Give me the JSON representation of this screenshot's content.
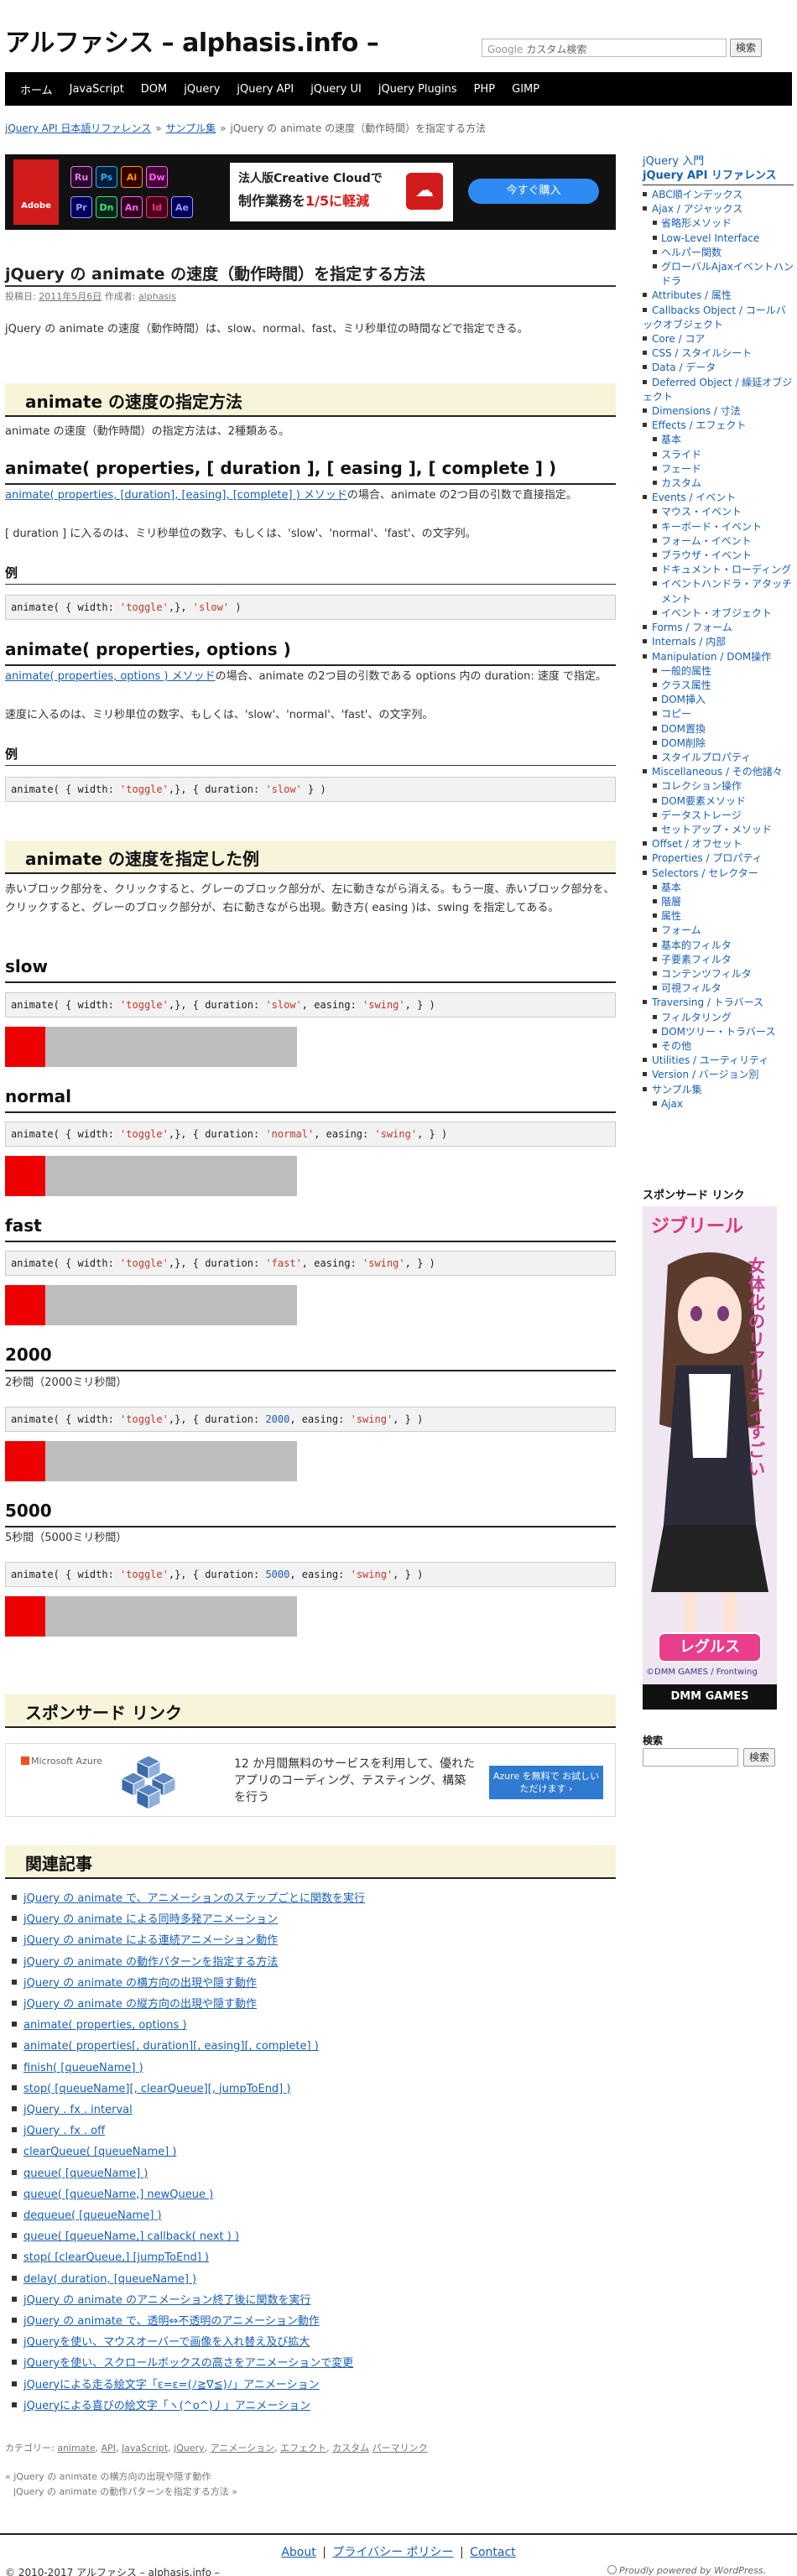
{
  "header": {
    "site_title": "アルファシス – alphasis.info –",
    "search_google": "Google",
    "search_placeholder": "カスタム検索",
    "search_button": "検索"
  },
  "nav": [
    "ホーム",
    "JavaScript",
    "DOM",
    "jQuery",
    "jQuery API",
    "jQuery UI",
    "jQuery Plugins",
    "PHP",
    "GIMP"
  ],
  "breadcrumb": {
    "items": [
      "jQuery API 日本語リファレンス",
      "サンプル集"
    ],
    "current": "jQuery の animate の速度（動作時間）を指定する方法"
  },
  "ad_banner": {
    "brand": "Adobe",
    "apps": [
      {
        "label": "Ru",
        "fg": "#ea77ff",
        "bg": "#2a0a2a"
      },
      {
        "label": "Ps",
        "fg": "#31a8ff",
        "bg": "#001e36"
      },
      {
        "label": "Ai",
        "fg": "#ff9a00",
        "bg": "#330000"
      },
      {
        "label": "Dw",
        "fg": "#ff61f6",
        "bg": "#470137"
      },
      {
        "label": "Pr",
        "fg": "#9999ff",
        "bg": "#00005b"
      },
      {
        "label": "Dn",
        "fg": "#4de36a",
        "bg": "#06261e"
      },
      {
        "label": "An",
        "fg": "#ff61f6",
        "bg": "#2e0019"
      },
      {
        "label": "Id",
        "fg": "#ff3366",
        "bg": "#49021f"
      },
      {
        "label": "Ae",
        "fg": "#9999ff",
        "bg": "#00005b"
      }
    ],
    "line1": "法人版Creative Cloudで",
    "line2_a": "制作業務を",
    "line2_b": "1/5に軽減",
    "cta": "今すぐ購入"
  },
  "post": {
    "title": "jQuery の animate の速度（動作時間）を指定する方法",
    "meta_prefix": "投稿日:",
    "meta_date": "2011年5月6日",
    "meta_author_prefix": "作成者:",
    "meta_author": "alphasis",
    "intro": "jQuery の animate の速度（動作時間）は、slow、normal、fast、ミリ秒単位の時間などで指定できる。",
    "h2_method": "animate の速度の指定方法",
    "method_text": "animate の速度（動作時間）の指定方法は、2種類ある。",
    "h3_a": "animate( properties, [ duration ], [ easing ], [ complete ] )",
    "a_link": "animate( properties, [duration], [easing], [complete] ) メソッド",
    "a_text1": "の場合、animate の2つ目の引数で直接指定。",
    "a_text2": "[ duration ] に入るのは、ミリ秒単位の数字、もしくは、'slow'、'normal'、'fast'、の文字列。",
    "h4_ex1": "例",
    "h3_b": "animate( properties, options )",
    "b_link": "animate( properties, options ) メソッド",
    "b_text1": "の場合、animate の2つ目の引数である options 内の duration: 速度 で指定。",
    "b_text2": "速度に入るのは、ミリ秒単位の数字、もしくは、'slow'、'normal'、'fast'、の文字列。",
    "h4_ex2": "例",
    "h2_example": "animate の速度を指定した例",
    "example_text": "赤いブロック部分を、クリックすると、グレーのブロック部分が、左に動きながら消える。もう一度、赤いブロック部分を、クリックすると、グレーのブロック部分が、右に動きながら出現。動き方( easing )は、swing を指定してある。",
    "h3_slow": "slow",
    "h3_normal": "normal",
    "h3_fast": "fast",
    "h3_2000": "2000",
    "note_2000": "2秒間（2000ミリ秒間）",
    "h3_5000": "5000",
    "note_5000": "5秒間（5000ミリ秒間）"
  },
  "code": {
    "ex1_pre": "animate( { width: ",
    "ex1_str": "'toggle'",
    "ex1_mid": ",}, ",
    "ex1_val": "'slow'",
    "ex1_post": " )",
    "ex2_pre": "animate( { width: ",
    "ex2_str": "'toggle'",
    "ex2_mid": ",}, { duration: ",
    "ex2_val": "'slow'",
    "ex2_post": " } )",
    "slow_val": "'slow'",
    "normal_val": "'normal'",
    "fast_val": "'fast'",
    "v2000": "2000",
    "v5000": "5000",
    "demo_pre": "animate( { width: ",
    "demo_str": "'toggle'",
    "demo_mid": ",}, { duration: ",
    "demo_ease_pre": ", easing: ",
    "demo_ease": "'swing'",
    "demo_post": ", } )"
  },
  "sponsor": {
    "h2": "スポンサード リンク",
    "ms_label": "Microsoft Azure",
    "text": "12 か月間無料のサービスを利用して、優れたアプリのコーディング、テスティング、構築を行う",
    "btn": "Azure を無料で お試しいただけます ›"
  },
  "related": {
    "h2": "関連記事",
    "items": [
      "jQuery の animate で、アニメーションのステップごとに関数を実行",
      "jQuery の animate による同時多発アニメーション",
      "jQuery の animate による連続アニメーション動作",
      "jQuery の animate の動作パターンを指定する方法",
      "jQuery の animate の横方向の出現や隠す動作",
      "jQuery の animate の縦方向の出現や隠す動作",
      "animate( properties, options )",
      "animate( properties[, duration][, easing][, complete] )",
      "finish( [queueName] )",
      "stop( [queueName][, clearQueue][, jumpToEnd] )",
      "jQuery . fx . interval",
      "jQuery . fx . off",
      "clearQueue( [queueName] )",
      "queue( [queueName] )",
      "queue( [queueName,] newQueue )",
      "dequeue( [queueName] )",
      "queue( [queueName,] callback( next ) )",
      "stop( [clearQueue,] [jumpToEnd] )",
      "delay( duration, [queueName] )",
      "jQuery の animate のアニメーション終了後に関数を実行",
      "jQuery の animate で、透明⇔不透明のアニメーション動作",
      "jQueryを使い、マウスオーバーで画像を入れ替え及び拡大",
      "jQueryを使い、スクロールボックスの高さをアニメーションで変更",
      "jQueryによる走る絵文字「ε=ε=(ﾉ≧∇≦)ﾉ」アニメーション",
      "jQueryによる喜びの絵文字「ヽ(^o^)丿」アニメーション"
    ]
  },
  "categories": {
    "label": "カテゴリー:",
    "items": [
      "animate",
      "API",
      "JavaScript",
      "jQuery",
      "アニメーション",
      "エフェクト",
      "カスタム"
    ],
    "permalink": "パーマリンク"
  },
  "prev_next": {
    "prev": "« jQuery の animate の横方向の出現や隠す動作",
    "next": "jQuery の animate の動作パターンを指定する方法 »"
  },
  "footer": {
    "links": [
      "About",
      "プライバシー ポリシー",
      "Contact"
    ],
    "copyright": "© 2010-2017 アルファシス – alphasis.info –",
    "credit": "Proudly powered by WordPress."
  },
  "sidebar": {
    "head1": "jQuery 入門",
    "head2": "jQuery API リファレンス",
    "items": [
      {
        "t": "ABC順インデックス",
        "l": 1
      },
      {
        "t": "Ajax / アジャックス",
        "l": 1
      },
      {
        "t": "省略形メソッド",
        "l": 2
      },
      {
        "t": "Low-Level Interface",
        "l": 2
      },
      {
        "t": "ヘルパー関数",
        "l": 2
      },
      {
        "t": "グローバルAjaxイベントハンドラ",
        "l": 2
      },
      {
        "t": "Attributes / 属性",
        "l": 1
      },
      {
        "t": "Callbacks Object / コールバックオブジェクト",
        "l": 1
      },
      {
        "t": "Core / コア",
        "l": 1
      },
      {
        "t": "CSS / スタイルシート",
        "l": 1
      },
      {
        "t": "Data / データ",
        "l": 1
      },
      {
        "t": "Deferred Object / 繰延オブジェクト",
        "l": 1
      },
      {
        "t": "Dimensions / 寸法",
        "l": 1
      },
      {
        "t": "Effects / エフェクト",
        "l": 1
      },
      {
        "t": "基本",
        "l": 2
      },
      {
        "t": "スライド",
        "l": 2
      },
      {
        "t": "フェード",
        "l": 2
      },
      {
        "t": "カスタム",
        "l": 2
      },
      {
        "t": "Events / イベント",
        "l": 1
      },
      {
        "t": "マウス・イベント",
        "l": 2
      },
      {
        "t": "キーボード・イベント",
        "l": 2
      },
      {
        "t": "フォーム・イベント",
        "l": 2
      },
      {
        "t": "ブラウザ・イベント",
        "l": 2
      },
      {
        "t": "ドキュメント・ローディング",
        "l": 2
      },
      {
        "t": "イベントハンドラ・アタッチメント",
        "l": 2
      },
      {
        "t": "イベント・オブジェクト",
        "l": 2
      },
      {
        "t": "Forms / フォーム",
        "l": 1
      },
      {
        "t": "Internals / 内部",
        "l": 1
      },
      {
        "t": "Manipulation / DOM操作",
        "l": 1
      },
      {
        "t": "一般的属性",
        "l": 2
      },
      {
        "t": "クラス属性",
        "l": 2
      },
      {
        "t": "DOM挿入",
        "l": 2
      },
      {
        "t": "コピー",
        "l": 2
      },
      {
        "t": "DOM置換",
        "l": 2
      },
      {
        "t": "DOM削除",
        "l": 2
      },
      {
        "t": "スタイルプロパティ",
        "l": 2
      },
      {
        "t": "Miscellaneous / その他諸々",
        "l": 1
      },
      {
        "t": "コレクション操作",
        "l": 2
      },
      {
        "t": "DOM要素メソッド",
        "l": 2
      },
      {
        "t": "データストレージ",
        "l": 2
      },
      {
        "t": "セットアップ・メソッド",
        "l": 2
      },
      {
        "t": "Offset / オフセット",
        "l": 1
      },
      {
        "t": "Properties / プロパティ",
        "l": 1
      },
      {
        "t": "Selectors / セレクター",
        "l": 1
      },
      {
        "t": "基本",
        "l": 2
      },
      {
        "t": "階層",
        "l": 2
      },
      {
        "t": "属性",
        "l": 2
      },
      {
        "t": "フォーム",
        "l": 2
      },
      {
        "t": "基本的フィルタ",
        "l": 2
      },
      {
        "t": "子要素フィルタ",
        "l": 2
      },
      {
        "t": "コンテンツフィルタ",
        "l": 2
      },
      {
        "t": "可視フィルタ",
        "l": 2
      },
      {
        "t": "Traversing / トラバース",
        "l": 1
      },
      {
        "t": "フィルタリング",
        "l": 2
      },
      {
        "t": "DOMツリー・トラバース",
        "l": 2
      },
      {
        "t": "その他",
        "l": 2
      },
      {
        "t": "Utilities / ユーティリティ",
        "l": 1
      },
      {
        "t": "Version / バージョン別",
        "l": 1
      },
      {
        "t": "サンプル集",
        "l": 1
      },
      {
        "t": "Ajax",
        "l": 2
      }
    ],
    "sponsor_label": "スポンサード リンク",
    "sponsor_img_text1": "ジブリール",
    "sponsor_img_text2": "女体化のリアリティすごい",
    "sponsor_img_btn": "レグルス",
    "sponsor_img_brand": "DMM GAMES",
    "sponsor_img_copy": "©DMM GAMES / Frontwing",
    "search_label": "検索",
    "search_button": "検索"
  }
}
